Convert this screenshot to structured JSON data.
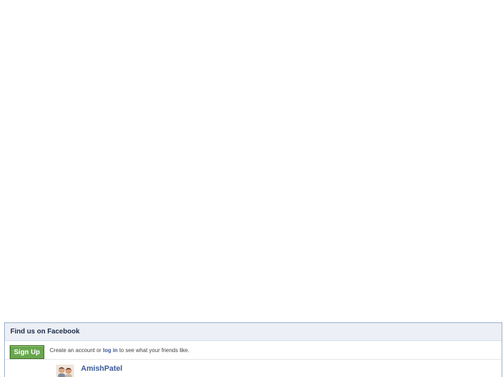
{
  "widget": {
    "title": "Find us on Facebook",
    "signup_button": "Sign Up",
    "signup_text_before": "Create an account or",
    "login_link": "log in",
    "signup_text_after": "to see what your friends like.",
    "fans": [
      {
        "name": "AmishPatel",
        "avatar": "person-pair-avatar-icon"
      }
    ]
  },
  "colors": {
    "header_bg": "#eceff5",
    "border": "#9aafca",
    "button_green": "#69a74e",
    "link_blue": "#3b5998"
  }
}
